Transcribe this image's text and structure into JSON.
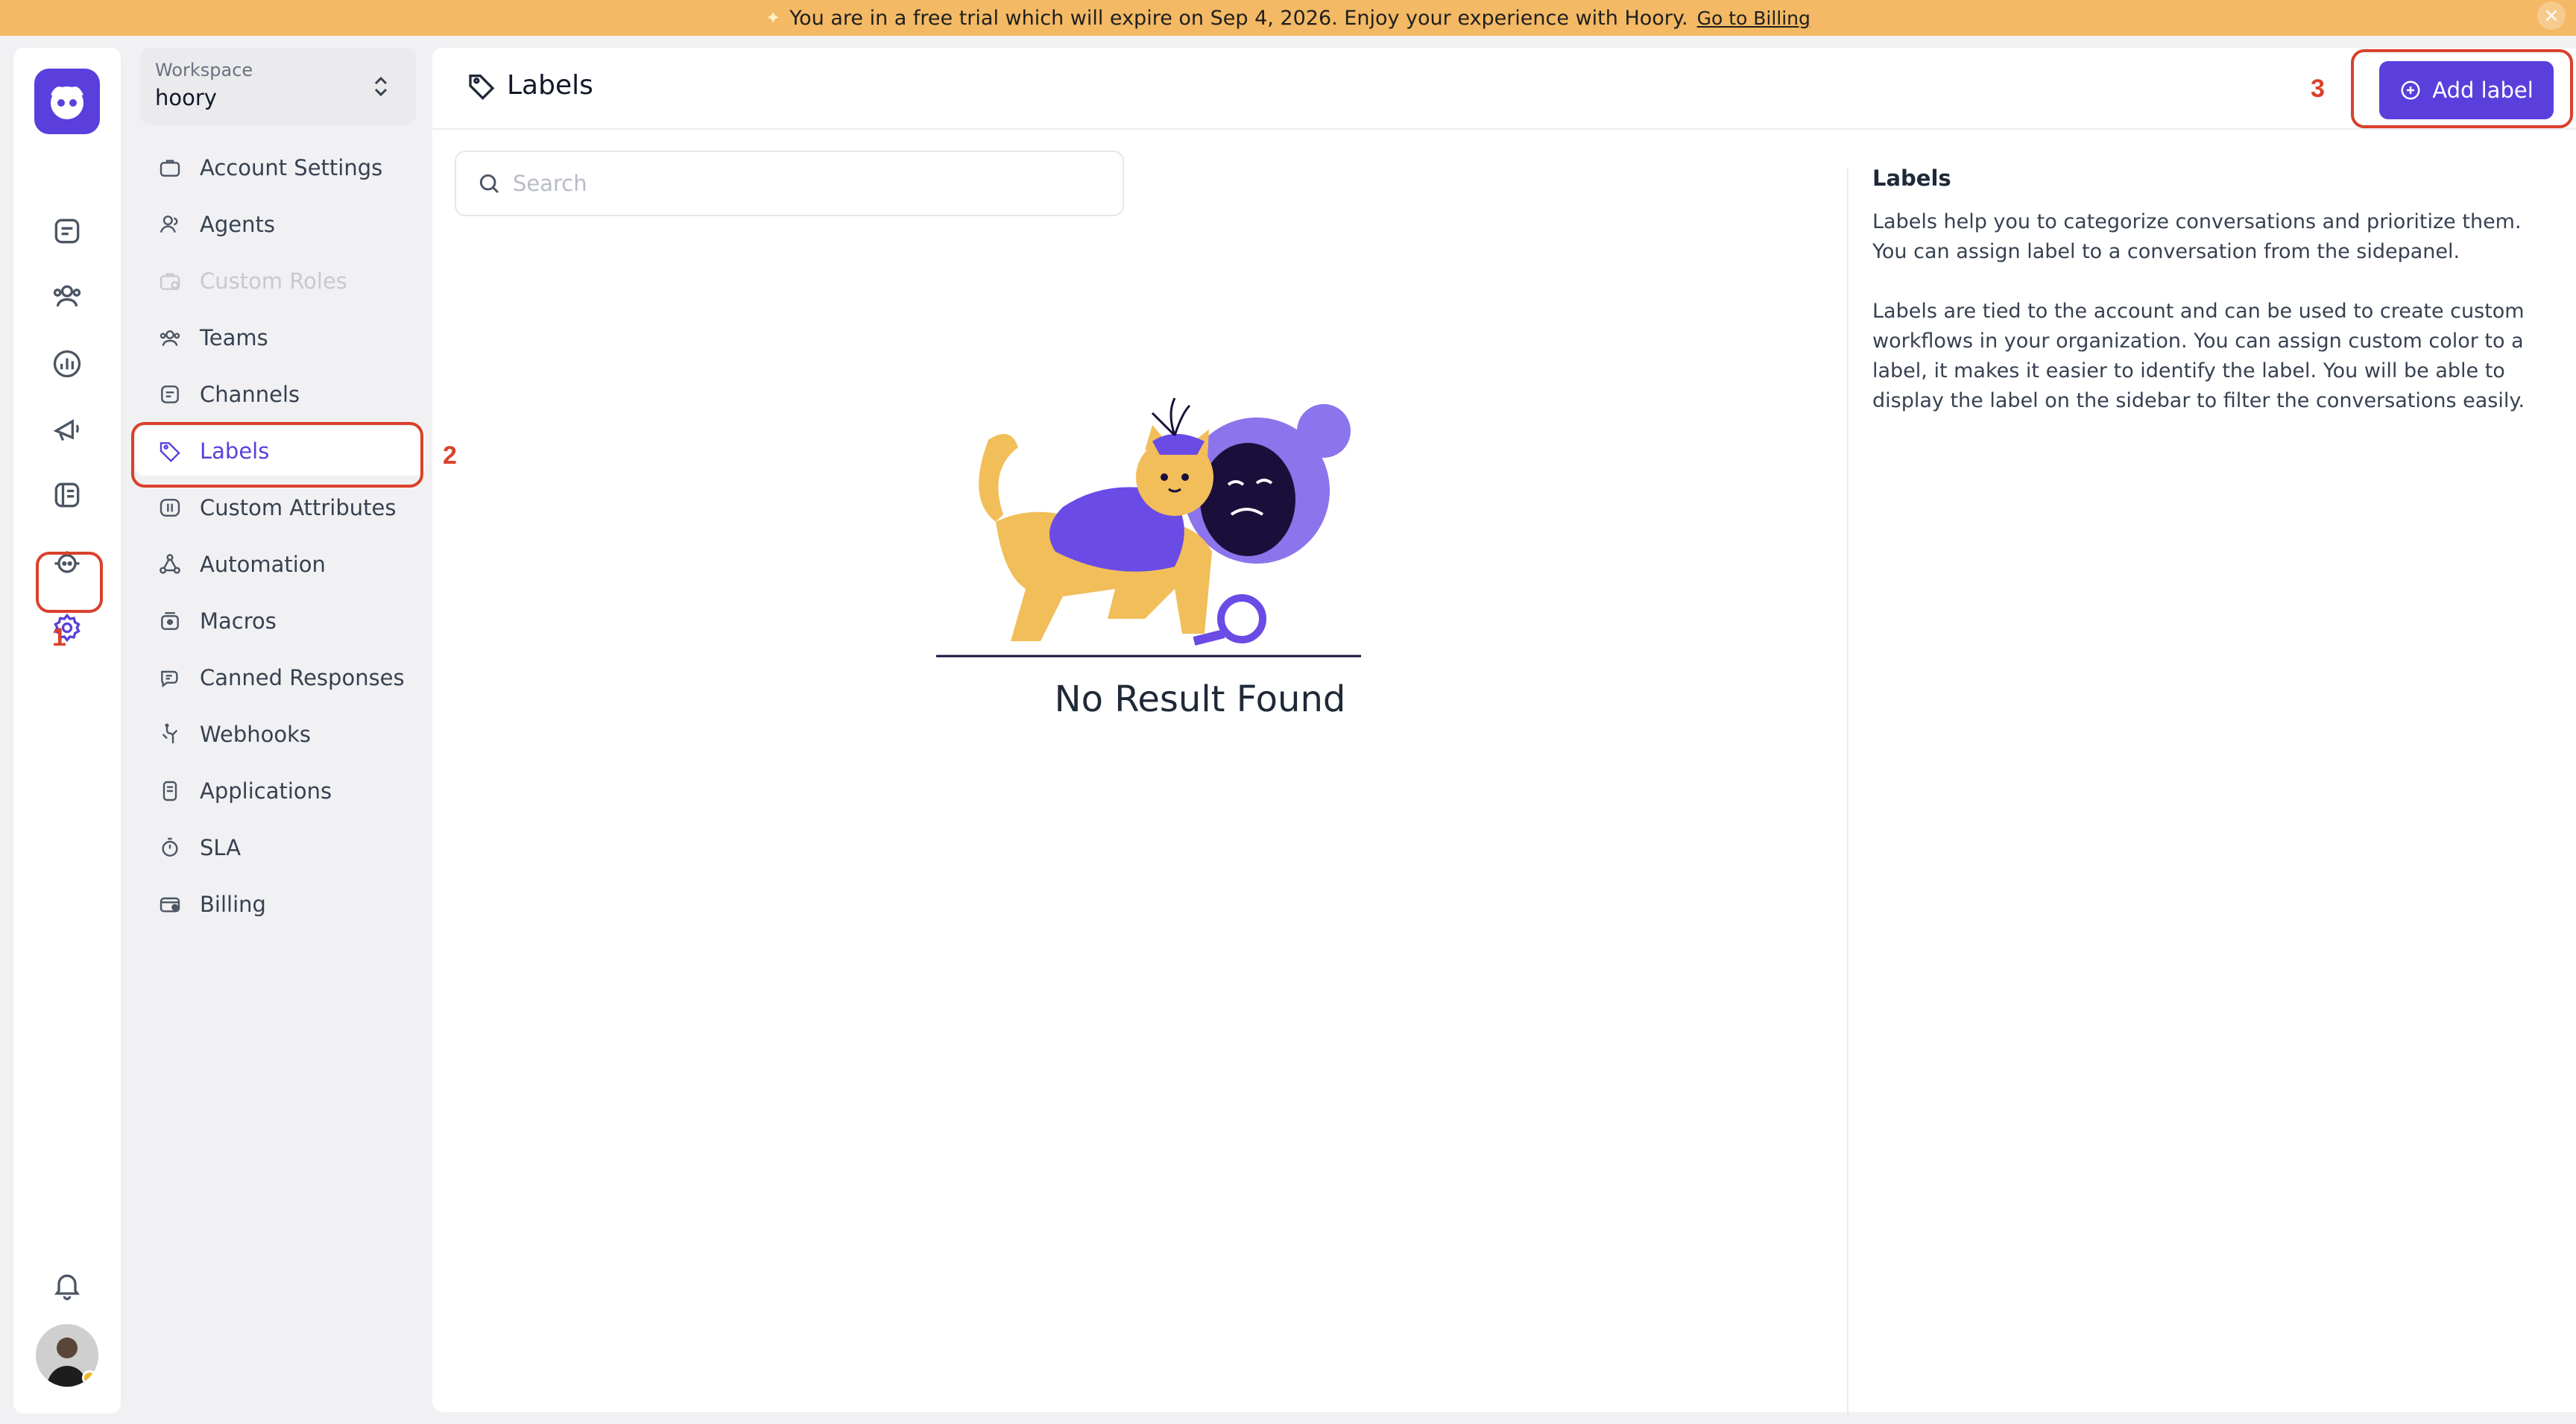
{
  "banner": {
    "icon": "sparkle-icon",
    "message": "You are in a free trial which will expire on Sep 4, 2026. Enjoy your experience with Hoory.",
    "link_label": "Go to Billing",
    "close_icon": "close-icon"
  },
  "rail": {
    "items": [
      {
        "name": "conversations",
        "icon": "chat-icon"
      },
      {
        "name": "contacts",
        "icon": "contacts-icon"
      },
      {
        "name": "reports",
        "icon": "reports-icon"
      },
      {
        "name": "campaigns",
        "icon": "megaphone-icon"
      },
      {
        "name": "help-center",
        "icon": "book-icon"
      },
      {
        "name": "bot",
        "icon": "bot-icon"
      },
      {
        "name": "settings",
        "icon": "gear-icon",
        "active": true
      }
    ],
    "notifications_icon": "bell-icon"
  },
  "workspace": {
    "label": "Workspace",
    "value": "hoory"
  },
  "sidebar": {
    "items": [
      {
        "label": "Account Settings",
        "icon": "briefcase-icon"
      },
      {
        "label": "Agents",
        "icon": "user-icon"
      },
      {
        "label": "Custom Roles",
        "icon": "role-lock-icon",
        "disabled": true
      },
      {
        "label": "Teams",
        "icon": "team-icon"
      },
      {
        "label": "Channels",
        "icon": "inbox-icon"
      },
      {
        "label": "Labels",
        "icon": "tag-icon",
        "active": true
      },
      {
        "label": "Custom Attributes",
        "icon": "attribute-icon"
      },
      {
        "label": "Automation",
        "icon": "automation-icon"
      },
      {
        "label": "Macros",
        "icon": "macro-icon"
      },
      {
        "label": "Canned Responses",
        "icon": "canned-response-icon"
      },
      {
        "label": "Webhooks",
        "icon": "webhook-icon"
      },
      {
        "label": "Applications",
        "icon": "app-icon"
      },
      {
        "label": "SLA",
        "icon": "stopwatch-icon"
      },
      {
        "label": "Billing",
        "icon": "billing-icon"
      }
    ]
  },
  "header": {
    "title": "Labels",
    "add_label": "Add label"
  },
  "search": {
    "placeholder": "Search",
    "value": ""
  },
  "empty_state": {
    "message": "No Result Found"
  },
  "info_panel": {
    "title": "Labels",
    "paragraph1": "Labels help you to categorize conversations and prioritize them. You can assign label to a conversation from the sidepanel.",
    "paragraph2": "Labels are tied to the account and can be used to create custom workflows in your organization. You can assign custom color to a label, it makes it easier to identify the label. You will be able to display the label on the sidebar to filter the conversations easily."
  },
  "annotations": {
    "step1": "1",
    "step2": "2",
    "step3": "3"
  },
  "colors": {
    "brand": "#5b3fdc",
    "banner": "#f3b964",
    "annotation": "#d9412b"
  }
}
